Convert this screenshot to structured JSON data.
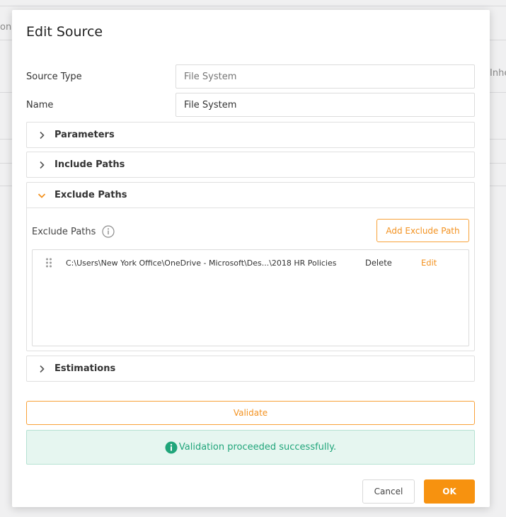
{
  "background": {
    "left_fragment": "ons",
    "right_fragment": "Inhe"
  },
  "modal": {
    "title": "Edit Source",
    "source_type": {
      "label": "Source Type",
      "placeholder": "File System"
    },
    "name": {
      "label": "Name",
      "value": "File System"
    },
    "sections": {
      "parameters": {
        "title": "Parameters",
        "expanded": false
      },
      "include_paths": {
        "title": "Include Paths",
        "expanded": false
      },
      "exclude_paths": {
        "title": "Exclude Paths",
        "expanded": true,
        "field_label": "Exclude Paths",
        "add_button": "Add Exclude Path",
        "paths": [
          {
            "path": "C:\\Users\\New York Office\\OneDrive - Microsoft\\Des...\\2018 HR Policies",
            "delete": "Delete",
            "edit": "Edit"
          }
        ]
      },
      "estimations": {
        "title": "Estimations",
        "expanded": false
      }
    },
    "validate_button": "Validate",
    "validation_message": "Validation proceeded successfully.",
    "cancel_button": "Cancel",
    "ok_button": "OK"
  },
  "colors": {
    "accent": "#f7920f",
    "success": "#20a57a",
    "success_bg": "#e6f6f0"
  }
}
